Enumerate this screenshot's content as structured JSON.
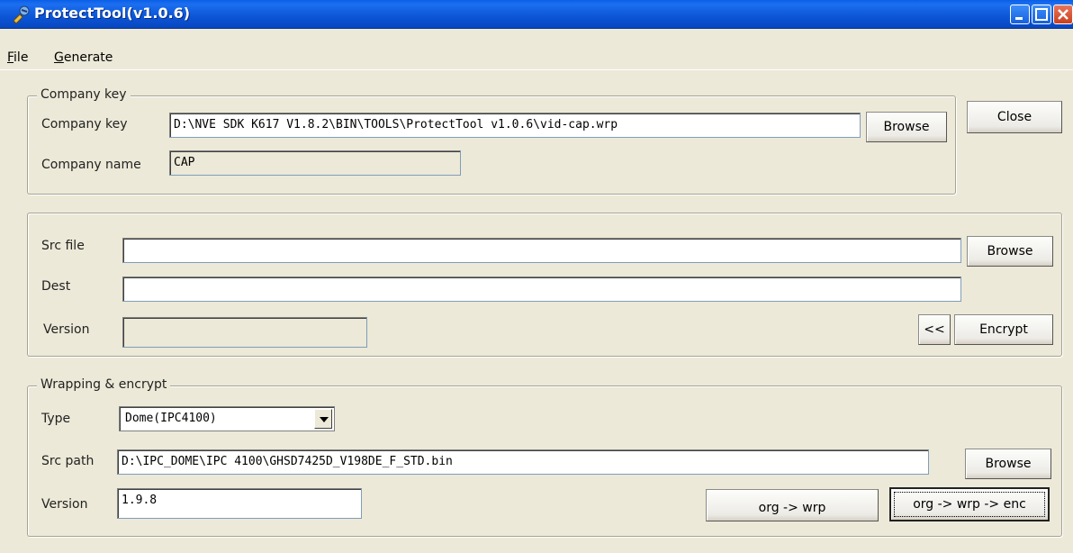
{
  "window": {
    "title": "ProtectTool(v1.0.6)",
    "titlebar_color": "#0b55d6",
    "icon": "app-tool-icon"
  },
  "menu": {
    "items": [
      "File",
      "Generate"
    ]
  },
  "company_group": {
    "title": "Company key",
    "key_label": "Company key",
    "key_value": "D:\\NVE SDK K617 V1.8.2\\BIN\\TOOLS\\ProtectTool v1.0.6\\vid-cap.wrp",
    "browse_label": "Browse",
    "name_label": "Company name",
    "name_value": "CAP"
  },
  "close_button": "Close",
  "encrypt_group": {
    "src_label": "Src file",
    "src_value": "",
    "browse_label": "Browse",
    "dest_label": "Dest",
    "dest_value": "",
    "version_label": "Version",
    "version_value": "",
    "back_label": "<<",
    "encrypt_label": "Encrypt"
  },
  "wrap_group": {
    "title": "Wrapping & encrypt",
    "type_label": "Type",
    "type_value": "Dome(IPC4100)",
    "src_path_label": "Src path",
    "src_path_value": "D:\\IPC_DOME\\IPC 4100\\GHSD7425D_V198DE_F_STD.bin",
    "browse_label": "Browse",
    "version_label": "Version",
    "version_value": "1.9.8",
    "org_wrp_label": "org -> wrp",
    "org_wrp_enc_label": "org -> wrp -> enc"
  }
}
